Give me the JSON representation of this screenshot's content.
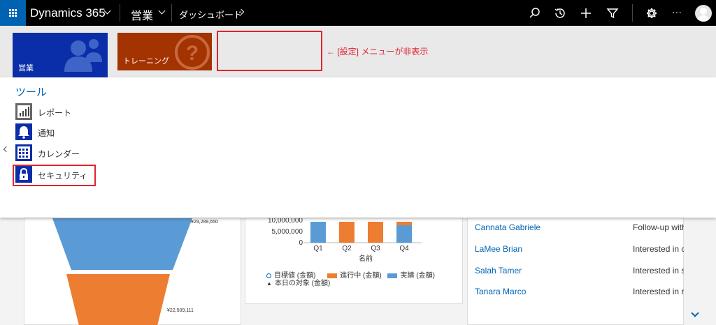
{
  "topbar": {
    "app_name": "Dynamics 365",
    "area": "営業",
    "breadcrumb": "ダッシュボード",
    "icons": [
      "waffle-icon",
      "search-icon",
      "history-icon",
      "plus-icon",
      "filter-icon",
      "gear-icon",
      "ellipsis-icon",
      "user-avatar-icon"
    ],
    "ellipsis": "···"
  },
  "tiles": {
    "sales_label": "営業",
    "training_label": "トレーニング",
    "callout": "← [設定] メニューが非表示"
  },
  "panel": {
    "heading": "ツール",
    "items": [
      {
        "label": "レポート",
        "icon": "report-icon"
      },
      {
        "label": "通知",
        "icon": "bell-icon"
      },
      {
        "label": "カレンダー",
        "icon": "calendar-icon"
      },
      {
        "label": "セキュリティ",
        "icon": "lock-icon"
      }
    ]
  },
  "funnel": {
    "labels": [
      "¥29,289,650",
      "¥22,509,111"
    ]
  },
  "chart_data": {
    "type": "bar",
    "categories": [
      "Q1",
      "Q2",
      "Q3",
      "Q4"
    ],
    "y_ticks": [
      "10,000,000",
      "5,000,000",
      "0"
    ],
    "xlabel": "名前",
    "series": [
      {
        "name": "目標値 (金額)",
        "color": "#0063b1",
        "marker": "circle-outline"
      },
      {
        "name": "進行中 (金額)",
        "color": "#ed7d31",
        "values": [
          0,
          6000000,
          6000000,
          1000000
        ]
      },
      {
        "name": "実績 (金額)",
        "color": "#5b9bd5",
        "values": [
          6000000,
          0,
          0,
          5000000
        ]
      },
      {
        "name": "本日の対象 (金額)",
        "color": "#000000",
        "marker": "triangle"
      }
    ]
  },
  "activities": [
    {
      "name": "Cannata Gabriele",
      "subject": "Follow-up with"
    },
    {
      "name": "LaMee Brian",
      "subject": "Interested in c"
    },
    {
      "name": "Salah Tamer",
      "subject": "Interested in s"
    },
    {
      "name": "Tanara Marco",
      "subject": "Interested in r"
    }
  ]
}
